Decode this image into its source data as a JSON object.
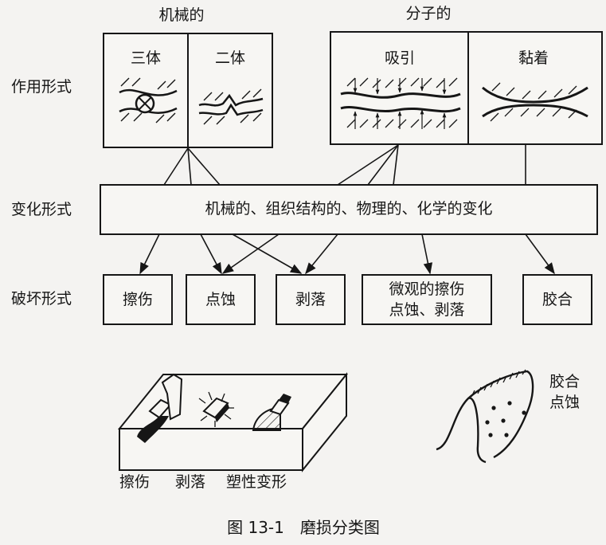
{
  "headers": {
    "mechanical": "机械的",
    "molecular": "分子的"
  },
  "rows": {
    "interaction": "作用形式",
    "change": "变化形式",
    "damage": "破坏形式"
  },
  "interaction_boxes": {
    "three_body": "三体",
    "two_body": "二体",
    "attraction": "吸引",
    "adhesion": "黏着"
  },
  "change_text": "机械的、组织结构的、物理的、化学的变化",
  "damage_boxes": {
    "abrasion": "擦伤",
    "pitting": "点蚀",
    "spalling": "剥落",
    "micro_line1": "微观的擦伤",
    "micro_line2": "点蚀、剥落",
    "gluing": "胶合"
  },
  "illustration": {
    "left_labels": [
      "擦伤",
      "剥落",
      "塑性变形"
    ],
    "right_label_line1": "胶合",
    "right_label_line2": "点蚀"
  },
  "caption": "图 13-1　磨损分类图"
}
